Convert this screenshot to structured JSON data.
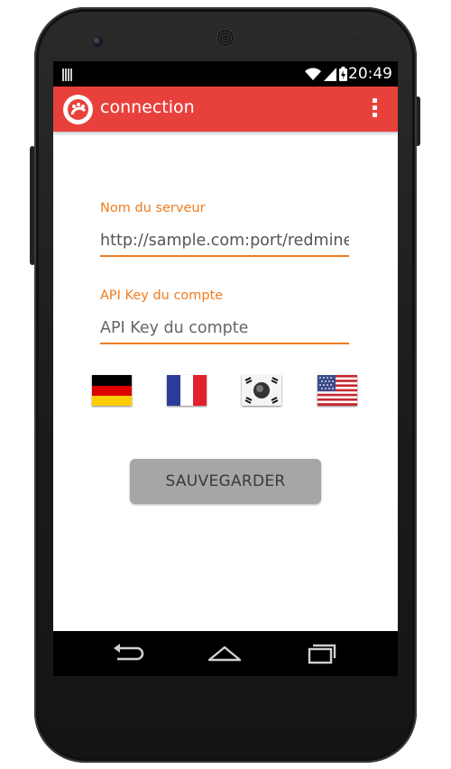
{
  "status_bar": {
    "time": "20:49"
  },
  "app_bar": {
    "title": "connection"
  },
  "form": {
    "server": {
      "label": "Nom du serveur",
      "value": "http://sample.com:port/redmine/",
      "placeholder": ""
    },
    "api_key": {
      "label": "API Key du compte",
      "value": "",
      "placeholder": "API Key du compte"
    }
  },
  "flags": [
    "german-flag-icon",
    "french-flag-icon",
    "korean-flag-icon",
    "us-flag-icon"
  ],
  "save_label": "SAUVEGARDER",
  "colors": {
    "accent": "#f07c1e",
    "appbar": "#e8413b",
    "button": "#a6a6a6"
  }
}
